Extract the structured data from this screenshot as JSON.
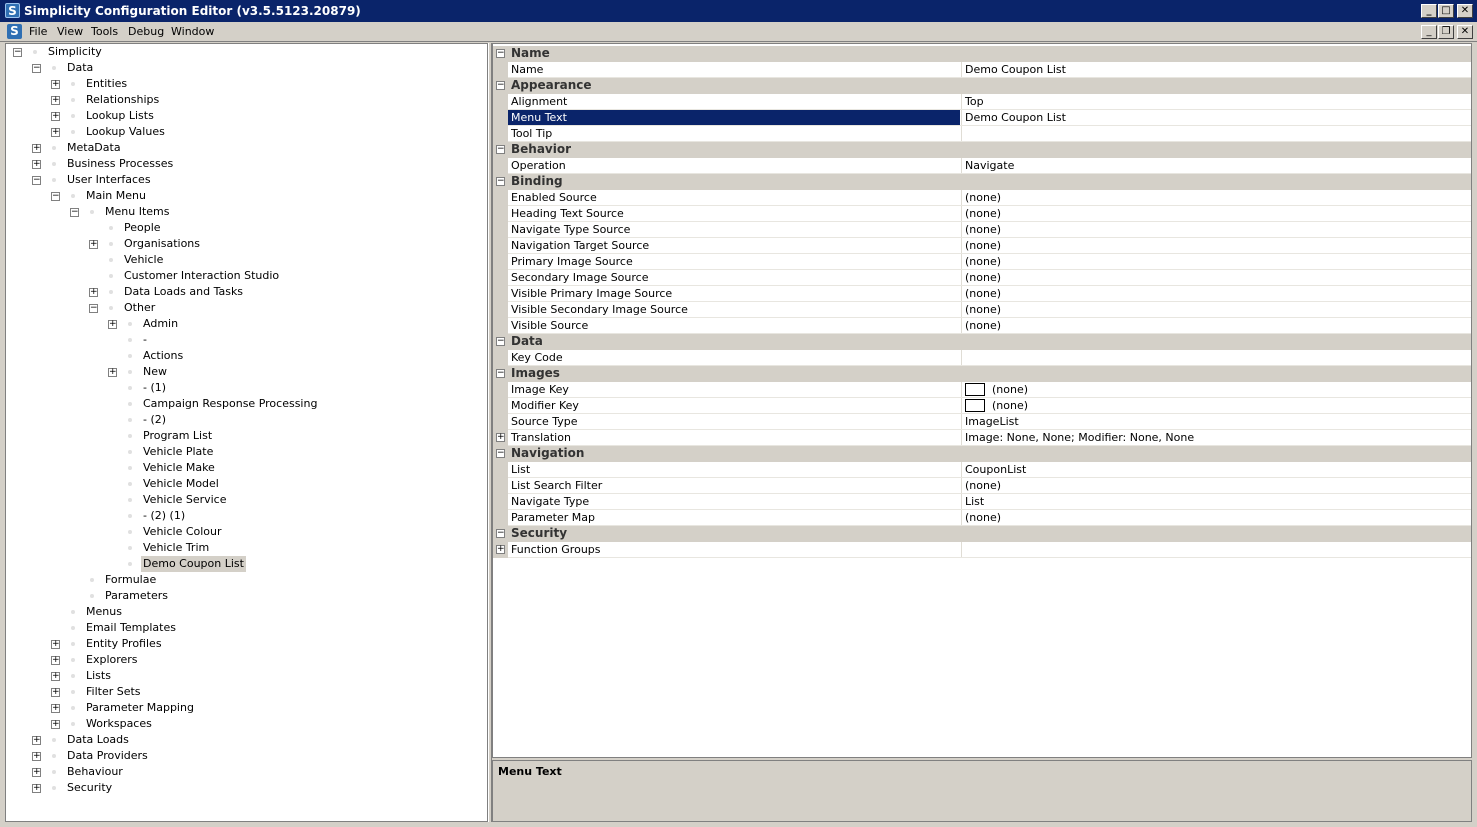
{
  "window": {
    "title": "Simplicity Configuration Editor (v3.5.5123.20879)",
    "app_icon_letter": "S"
  },
  "menu": [
    "File",
    "View",
    "Tools",
    "Debug",
    "Window"
  ],
  "tree": [
    {
      "label": "Simplicity",
      "expander": "minus"
    },
    {
      "label": "Data",
      "expander": "minus"
    },
    {
      "label": "Entities",
      "expander": "plus"
    },
    {
      "label": "Relationships",
      "expander": "plus"
    },
    {
      "label": "Lookup Lists",
      "expander": "plus"
    },
    {
      "label": "Lookup Values",
      "expander": "plus"
    },
    {
      "label": "MetaData",
      "expander": "plus"
    },
    {
      "label": "Business Processes",
      "expander": "plus"
    },
    {
      "label": "User Interfaces",
      "expander": "minus"
    },
    {
      "label": "Main Menu",
      "expander": "minus"
    },
    {
      "label": "Menu Items",
      "expander": "minus"
    },
    {
      "label": "People",
      "expander": ""
    },
    {
      "label": "Organisations",
      "expander": "plus"
    },
    {
      "label": "Vehicle",
      "expander": ""
    },
    {
      "label": "Customer Interaction Studio",
      "expander": ""
    },
    {
      "label": "Data Loads and Tasks",
      "expander": "plus"
    },
    {
      "label": "Other",
      "expander": "minus"
    },
    {
      "label": "Admin",
      "expander": "plus"
    },
    {
      "label": "-",
      "expander": ""
    },
    {
      "label": "Actions",
      "expander": ""
    },
    {
      "label": "New",
      "expander": "plus"
    },
    {
      "label": "- (1)",
      "expander": ""
    },
    {
      "label": "Campaign Response Processing",
      "expander": ""
    },
    {
      "label": "- (2)",
      "expander": ""
    },
    {
      "label": "Program List",
      "expander": ""
    },
    {
      "label": "Vehicle Plate",
      "expander": ""
    },
    {
      "label": "Vehicle Make",
      "expander": ""
    },
    {
      "label": "Vehicle Model",
      "expander": ""
    },
    {
      "label": "Vehicle Service",
      "expander": ""
    },
    {
      "label": "- (2) (1)",
      "expander": ""
    },
    {
      "label": "Vehicle Colour",
      "expander": ""
    },
    {
      "label": "Vehicle Trim",
      "expander": ""
    },
    {
      "label": "Demo Coupon List",
      "expander": "",
      "selected": true
    },
    {
      "label": "Formulae",
      "expander": ""
    },
    {
      "label": "Parameters",
      "expander": ""
    },
    {
      "label": "Menus",
      "expander": ""
    },
    {
      "label": "Email Templates",
      "expander": ""
    },
    {
      "label": "Entity Profiles",
      "expander": "plus"
    },
    {
      "label": "Explorers",
      "expander": "plus"
    },
    {
      "label": "Lists",
      "expander": "plus"
    },
    {
      "label": "Filter Sets",
      "expander": "plus"
    },
    {
      "label": "Parameter Mapping",
      "expander": "plus"
    },
    {
      "label": "Workspaces",
      "expander": "plus"
    },
    {
      "label": "Data Loads",
      "expander": "plus"
    },
    {
      "label": "Data Providers",
      "expander": "plus"
    },
    {
      "label": "Behaviour",
      "expander": "plus"
    },
    {
      "label": "Security",
      "expander": "plus"
    }
  ],
  "properties": [
    {
      "category": "Name",
      "rows": [
        {
          "name": "Name",
          "value": "Demo Coupon List"
        }
      ]
    },
    {
      "category": "Appearance",
      "rows": [
        {
          "name": "Alignment",
          "value": "Top"
        },
        {
          "name": "Menu Text",
          "value": "Demo Coupon List",
          "selected": true
        },
        {
          "name": "Tool Tip",
          "value": ""
        }
      ]
    },
    {
      "category": "Behavior",
      "rows": [
        {
          "name": "Operation",
          "value": "Navigate"
        }
      ]
    },
    {
      "category": "Binding",
      "rows": [
        {
          "name": "Enabled Source",
          "value": "(none)"
        },
        {
          "name": "Heading Text Source",
          "value": "(none)"
        },
        {
          "name": "Navigate Type Source",
          "value": "(none)"
        },
        {
          "name": "Navigation Target Source",
          "value": "(none)"
        },
        {
          "name": "Primary Image Source",
          "value": "(none)"
        },
        {
          "name": "Secondary Image Source",
          "value": "(none)"
        },
        {
          "name": "Visible Primary Image Source",
          "value": "(none)"
        },
        {
          "name": "Visible Secondary Image Source",
          "value": "(none)"
        },
        {
          "name": "Visible Source",
          "value": "(none)"
        }
      ]
    },
    {
      "category": "Data",
      "rows": [
        {
          "name": "Key Code",
          "value": ""
        }
      ]
    },
    {
      "category": "Images",
      "rows": [
        {
          "name": "Image Key",
          "value": "(none)",
          "swatch": true
        },
        {
          "name": "Modifier Key",
          "value": "(none)",
          "swatch": true
        },
        {
          "name": "Source Type",
          "value": "ImageList"
        },
        {
          "name": "Translation",
          "value": "Image: None, None; Modifier: None, None",
          "expandable": true
        }
      ]
    },
    {
      "category": "Navigation",
      "rows": [
        {
          "name": "List",
          "value": "CouponList"
        },
        {
          "name": "List Search Filter",
          "value": "(none)"
        },
        {
          "name": "Navigate Type",
          "value": "List"
        },
        {
          "name": "Parameter Map",
          "value": "(none)"
        }
      ]
    },
    {
      "category": "Security",
      "rows": [
        {
          "name": "Function Groups",
          "value": "",
          "expandable": true
        }
      ]
    }
  ],
  "description": {
    "title": "Menu Text"
  },
  "icons": {
    "expand": "plus-box-icon",
    "collapse": "minus-box-icon",
    "node": "node-dot-icon",
    "minimize": "minimize-icon",
    "maximize": "maximize-icon",
    "restore": "restore-icon",
    "close": "close-icon"
  }
}
